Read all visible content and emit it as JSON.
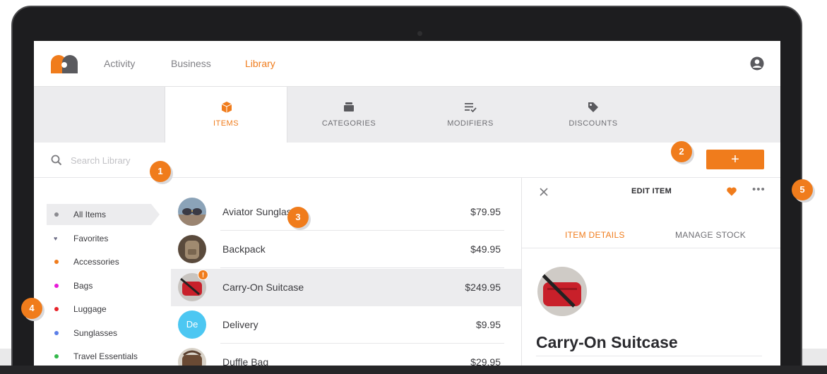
{
  "nav": {
    "links": [
      {
        "label": "Activity"
      },
      {
        "label": "Business"
      },
      {
        "label": "Library"
      }
    ],
    "active_link": "Library"
  },
  "tabs": [
    {
      "label": "ITEMS",
      "icon": "box-icon"
    },
    {
      "label": "CATEGORIES",
      "icon": "stack-icon"
    },
    {
      "label": "MODIFIERS",
      "icon": "list-check-icon"
    },
    {
      "label": "DISCOUNTS",
      "icon": "tag-icon"
    }
  ],
  "active_tab": "ITEMS",
  "search": {
    "placeholder": "Search Library",
    "value": ""
  },
  "add_button": {
    "label": "+"
  },
  "sidebar": {
    "items": [
      {
        "label": "All Items",
        "color": "#8b8b90"
      },
      {
        "label": "Favorites",
        "color": "#6f6f88"
      },
      {
        "label": "Accessories",
        "color": "#f07c1c"
      },
      {
        "label": "Bags",
        "color": "#e81ad8"
      },
      {
        "label": "Luggage",
        "color": "#e8232a"
      },
      {
        "label": "Sunglasses",
        "color": "#5b7fe8"
      },
      {
        "label": "Travel Essentials",
        "color": "#33b84a"
      }
    ],
    "active_item": "All Items"
  },
  "items": [
    {
      "name": "Aviator Sunglasses",
      "price": "$79.95"
    },
    {
      "name": "Backpack",
      "price": "$49.95"
    },
    {
      "name": "Carry-On Suitcase",
      "price": "$249.95",
      "badge": "!"
    },
    {
      "name": "Delivery",
      "price": "$9.95",
      "initials": "De"
    },
    {
      "name": "Duffle Bag",
      "price": "$29.95"
    }
  ],
  "selected_item": "Carry-On Suitcase",
  "edit_panel": {
    "title": "EDIT ITEM",
    "tabs": [
      {
        "label": "ITEM DETAILS"
      },
      {
        "label": "MANAGE STOCK"
      }
    ],
    "active_tab": "ITEM DETAILS",
    "more_label": "•••",
    "item_name": "Carry-On Suitcase"
  },
  "callouts": [
    "1",
    "2",
    "3",
    "4",
    "5"
  ],
  "colors": {
    "accent": "#f07c1c",
    "initials_bg": "#4cc7f2"
  }
}
